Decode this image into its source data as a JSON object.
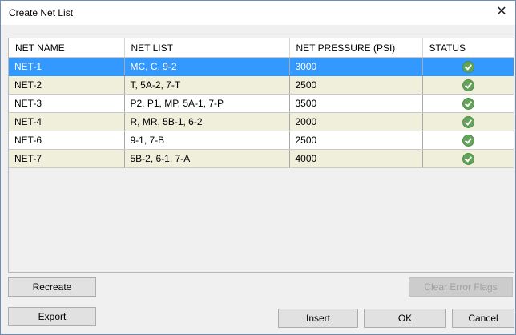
{
  "window": {
    "title": "Create Net List",
    "close_glyph": "✕"
  },
  "table": {
    "columns": [
      "NET NAME",
      "NET LIST",
      "NET PRESSURE (PSI)",
      "STATUS"
    ],
    "rows": [
      {
        "name": "NET-1",
        "list": "MC, C, 9-2",
        "pressure": "3000",
        "status": "ok",
        "selected": true
      },
      {
        "name": "NET-2",
        "list": "T, 5A-2, 7-T",
        "pressure": "2500",
        "status": "ok"
      },
      {
        "name": "NET-3",
        "list": "P2, P1, MP, 5A-1, 7-P",
        "pressure": "3500",
        "status": "ok"
      },
      {
        "name": "NET-4",
        "list": "R, MR, 5B-1, 6-2",
        "pressure": "2000",
        "status": "ok"
      },
      {
        "name": "NET-6",
        "list": "9-1, 7-B",
        "pressure": "2500",
        "status": "ok"
      },
      {
        "name": "NET-7",
        "list": "5B-2, 6-1, 7-A",
        "pressure": "4000",
        "status": "ok"
      }
    ],
    "status_icon": "check-circle-icon",
    "colors": {
      "selected": "#3399ff",
      "even_row": "#efefdc",
      "odd_row": "#ffffff",
      "status_ok": "#63a35a"
    }
  },
  "buttons": {
    "recreate": "Recreate",
    "clear_error_flags": "Clear Error Flags",
    "export": "Export",
    "insert": "Insert",
    "ok": "OK",
    "cancel": "Cancel"
  }
}
